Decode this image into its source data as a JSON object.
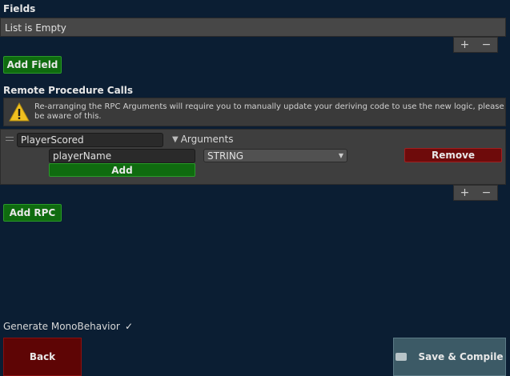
{
  "fields": {
    "header": "Fields",
    "empty_text": "List is Empty",
    "plus": "+",
    "minus": "−",
    "add_button": "Add Field"
  },
  "rpc": {
    "header": "Remote Procedure Calls",
    "warning": "Re-arranging the RPC Arguments will require you to manually update your deriving code to use the new logic, please be aware of this.",
    "items": [
      {
        "name": "PlayerScored",
        "arguments_label": "Arguments",
        "arguments": [
          {
            "name": "playerName",
            "type": "STRING"
          }
        ],
        "add_label": "Add",
        "remove_label": "Remove"
      }
    ],
    "plus": "+",
    "minus": "−",
    "add_button": "Add RPC"
  },
  "options": {
    "generate_monobehavior_label": "Generate MonoBehavior",
    "generate_monobehavior_checked": true
  },
  "footer": {
    "back_label": "Back",
    "save_label": "Save & Compile"
  },
  "colors": {
    "background": "#0b1e33",
    "green_button": "#0f6b0f",
    "red_button": "#6e0b0b",
    "save_button": "#3c5a66"
  }
}
